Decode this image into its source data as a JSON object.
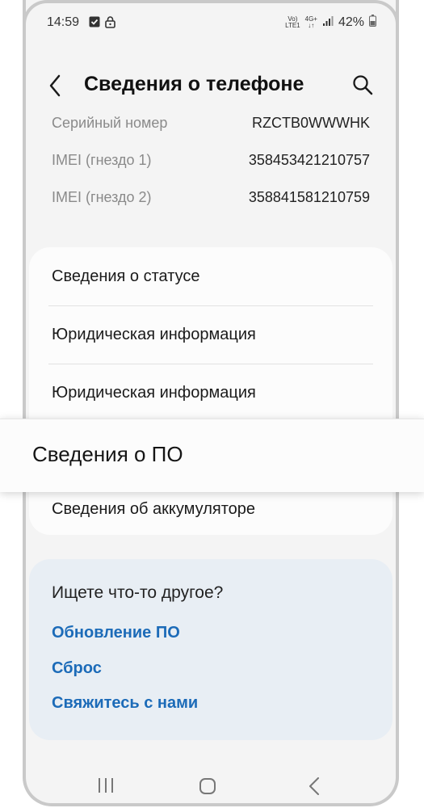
{
  "status_bar": {
    "time": "14:59",
    "network_top": "Vo)",
    "network_bottom": "LTE1",
    "signal_top": "4G+",
    "battery_percent": "42%"
  },
  "header": {
    "title": "Сведения о телефоне"
  },
  "info": [
    {
      "label": "Серийный номер",
      "value": "RZCTB0WWWHK"
    },
    {
      "label": "IMEI (гнездо 1)",
      "value": "358453421210757"
    },
    {
      "label": "IMEI (гнездо 2)",
      "value": "358841581210759"
    }
  ],
  "menu": [
    {
      "label": "Сведения о статусе"
    },
    {
      "label": "Юридическая информация"
    },
    {
      "label": "Юридическая информация"
    },
    {
      "label": "Сведения об аккумуляторе"
    }
  ],
  "popup": {
    "label": "Сведения о ПО"
  },
  "suggest": {
    "title": "Ищете что-то другое?",
    "links": [
      "Обновление ПО",
      "Сброс",
      "Свяжитесь с нами"
    ]
  },
  "colors": {
    "accent": "#1c6bb8",
    "background": "#f4f4f4",
    "suggest_bg": "#e8eef4"
  }
}
